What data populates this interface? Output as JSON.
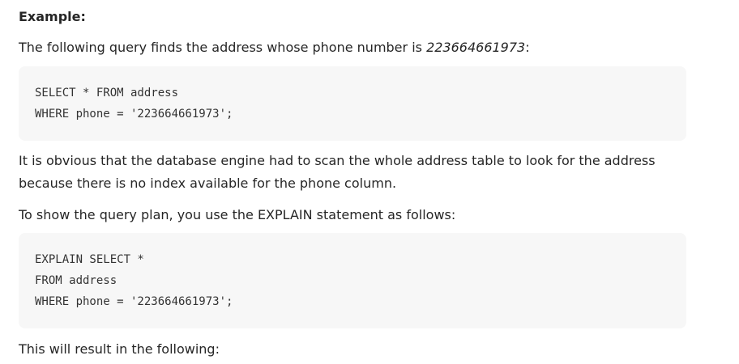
{
  "heading": "Example:",
  "intro": {
    "before": "The following query finds the address whose phone number is ",
    "phone": "223664661973",
    "after": ":"
  },
  "code1": [
    "SELECT * FROM address",
    "WHERE phone = '223664661973';"
  ],
  "explanation": "It is obvious that the database engine had to scan the whole address table to look for the address because there is no index available for the phone column.",
  "plan_intro": "To show the query plan, you use the EXPLAIN statement as follows:",
  "code2": [
    "EXPLAIN SELECT *",
    "FROM address",
    "WHERE phone = '223664661973';"
  ],
  "result_intro": "This will result in the following:"
}
